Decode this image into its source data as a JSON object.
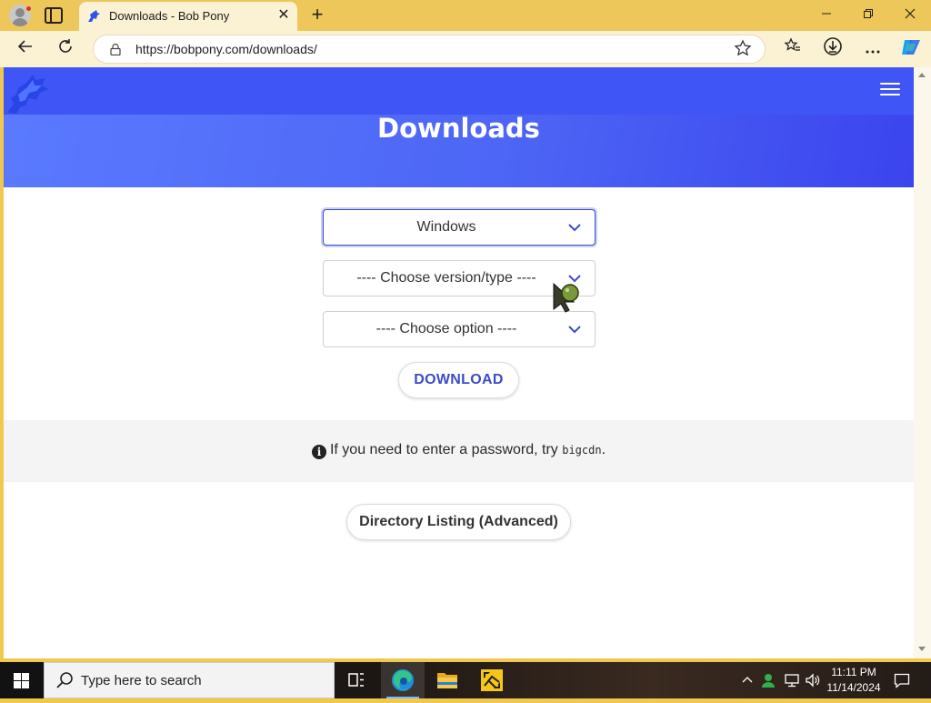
{
  "browser": {
    "tab_title": "Downloads - Bob Pony",
    "url": "https://bobpony.com/downloads/",
    "new_tab_symbol": "+",
    "tab_close_symbol": "✕"
  },
  "page": {
    "title": "Downloads",
    "os_select": {
      "value": "Windows"
    },
    "version_select": {
      "value": "---- Choose version/type ----"
    },
    "option_select": {
      "value": "---- Choose option ----"
    },
    "download_button": "DOWNLOAD",
    "notice": {
      "text_before": "If you need to enter a password, try ",
      "code": "bigcdn",
      "text_after": "."
    },
    "directory_button": "Directory Listing (Advanced)"
  },
  "taskbar": {
    "search_placeholder": "Type here to search",
    "time": "11:11 PM",
    "date": "11/14/2024"
  },
  "colors": {
    "accent": "#3b4cc7",
    "hero_start": "#5a7aff",
    "hero_end": "#3b44ee",
    "browser_frame": "#eec75a"
  },
  "icons": [
    "profile-icon",
    "tab-actions-icon",
    "back-arrow-icon",
    "refresh-icon",
    "lock-icon",
    "favorite-star-icon",
    "favorites-icon",
    "downloads-icon",
    "more-icon",
    "copilot-icon",
    "menu-icon",
    "info-icon",
    "chevron-down-icon",
    "windows-start-icon",
    "search-icon",
    "task-view-icon",
    "edge-icon",
    "file-explorer-icon"
  ]
}
